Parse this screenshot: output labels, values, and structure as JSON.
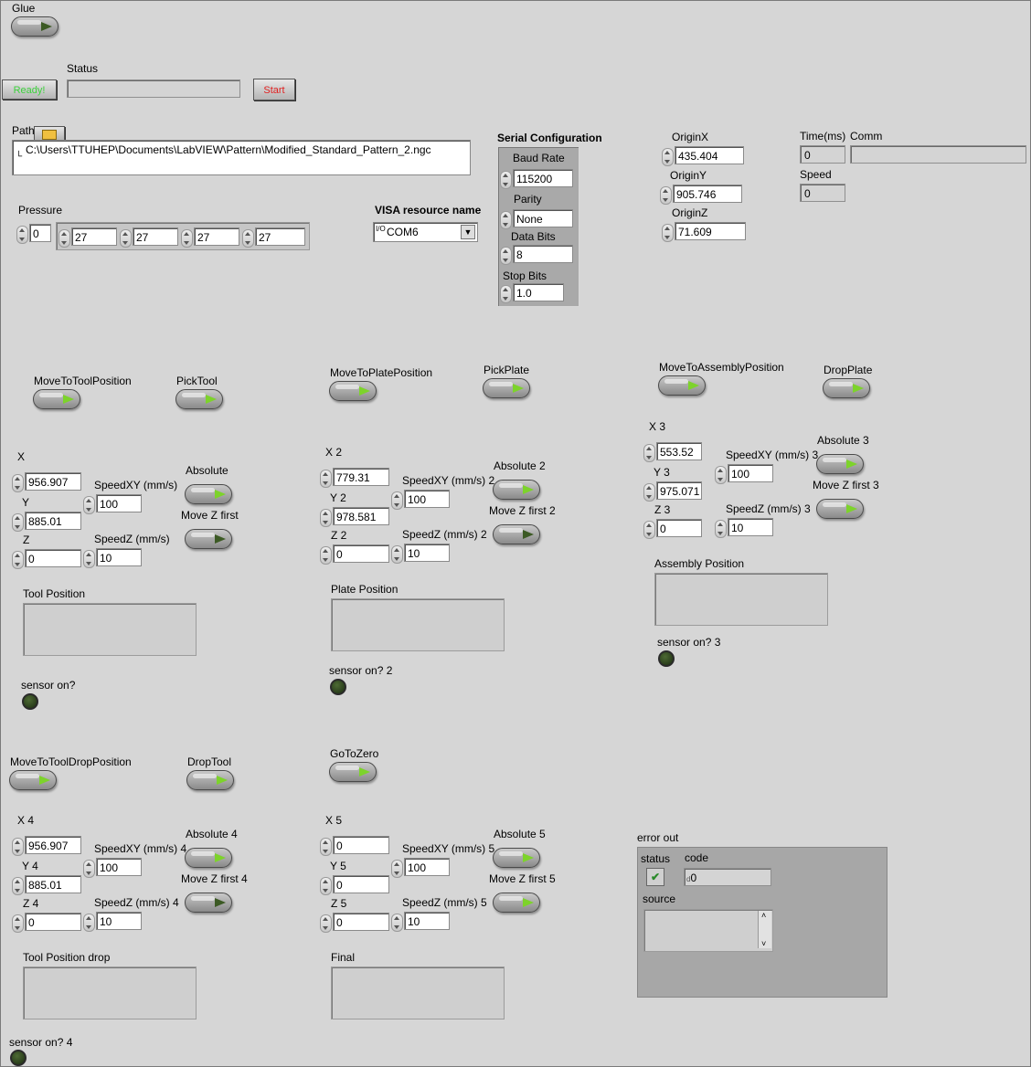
{
  "glue": {
    "label": "Glue",
    "on": false
  },
  "status": {
    "ready_label": "Ready!",
    "label": "Status",
    "value": "",
    "start_label": "Start"
  },
  "path": {
    "label": "Path",
    "value": "C:\\Users\\TTUHEP\\Documents\\LabVIEW\\Pattern\\Modified_Standard_Pattern_2.ngc"
  },
  "pressure": {
    "label": "Pressure",
    "index": "0",
    "values": [
      "27",
      "27",
      "27",
      "27"
    ]
  },
  "visa": {
    "label": "VISA resource name",
    "value": "COM6",
    "prefix": "I/O"
  },
  "serial": {
    "title": "Serial Configuration",
    "baud_label": "Baud Rate",
    "baud": "115200",
    "parity_label": "Parity",
    "parity": "None",
    "databits_label": "Data Bits",
    "databits": "8",
    "stopbits_label": "Stop Bits",
    "stopbits": "1.0"
  },
  "origin": {
    "x_label": "OriginX",
    "x": "435.404",
    "y_label": "OriginY",
    "y": "905.746",
    "z_label": "OriginZ",
    "z": "71.609"
  },
  "time": {
    "label": "Time(ms)",
    "value": "0"
  },
  "comm": {
    "label": "Comm",
    "value": ""
  },
  "speed": {
    "label": "Speed",
    "value": "0"
  },
  "actions": {
    "move_tool": "MoveToToolPosition",
    "pick_tool": "PickTool",
    "move_plate": "MoveToPlatePosition",
    "pick_plate": "PickPlate",
    "move_assembly": "MoveToAssemblyPosition",
    "drop_plate": "DropPlate",
    "move_tool_drop": "MoveToToolDropPosition",
    "drop_tool": "DropTool",
    "go_zero": "GoToZero"
  },
  "g1": {
    "x_label": "X",
    "x": "956.907",
    "y_label": "Y",
    "y": "885.01",
    "z_label": "Z",
    "z": "0",
    "sxy_label": "SpeedXY (mm/s)",
    "sxy": "100",
    "sz_label": "SpeedZ (mm/s)",
    "sz": "10",
    "abs_label": "Absolute",
    "mz_label": "Move Z first",
    "pos_label": "Tool Position",
    "sensor_label": "sensor on?"
  },
  "g2": {
    "x_label": "X 2",
    "x": "779.31",
    "y_label": "Y 2",
    "y": "978.581",
    "z_label": "Z 2",
    "z": "0",
    "sxy_label": "SpeedXY (mm/s) 2",
    "sxy": "100",
    "sz_label": "SpeedZ (mm/s) 2",
    "sz": "10",
    "abs_label": "Absolute 2",
    "mz_label": "Move Z first 2",
    "pos_label": "Plate Position",
    "sensor_label": "sensor on? 2"
  },
  "g3": {
    "x_label": "X 3",
    "x": "553.52",
    "y_label": "Y 3",
    "y": "975.071",
    "z_label": "Z 3",
    "z": "0",
    "sxy_label": "SpeedXY (mm/s) 3",
    "sxy": "100",
    "sz_label": "SpeedZ (mm/s) 3",
    "sz": "10",
    "abs_label": "Absolute 3",
    "mz_label": "Move Z first 3",
    "pos_label": "Assembly Position",
    "sensor_label": "sensor on? 3"
  },
  "g4": {
    "x_label": "X 4",
    "x": "956.907",
    "y_label": "Y 4",
    "y": "885.01",
    "z_label": "Z 4",
    "z": "0",
    "sxy_label": "SpeedXY (mm/s) 4",
    "sxy": "100",
    "sz_label": "SpeedZ (mm/s) 4",
    "sz": "10",
    "abs_label": "Absolute 4",
    "mz_label": "Move Z first 4",
    "pos_label": "Tool Position drop",
    "sensor_label": "sensor on? 4"
  },
  "g5": {
    "x_label": "X 5",
    "x": "0",
    "y_label": "Y 5",
    "y": "0",
    "z_label": "Z 5",
    "z": "0",
    "sxy_label": "SpeedXY (mm/s) 5",
    "sxy": "100",
    "sz_label": "SpeedZ (mm/s) 5",
    "sz": "10",
    "abs_label": "Absolute 5",
    "mz_label": "Move Z first 5",
    "pos_label": "Final"
  },
  "error_out": {
    "title": "error out",
    "status_label": "status",
    "code_label": "code",
    "code": "0",
    "code_prefix": "d",
    "source_label": "source",
    "source": ""
  },
  "colors": {
    "led_on": "#7dd32b",
    "led_off": "#3c5a24",
    "ready_text": "#3bd13b",
    "start_text": "#e02020"
  }
}
